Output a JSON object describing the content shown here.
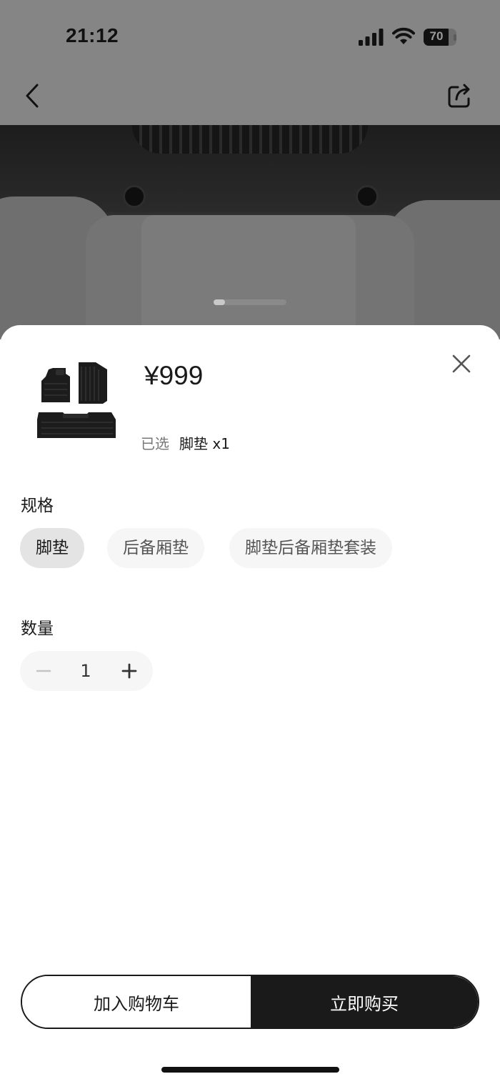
{
  "status_bar": {
    "time": "21:12",
    "battery": "70",
    "icons": [
      "signal-icon",
      "wifi-icon",
      "battery-icon"
    ]
  },
  "header": {
    "back_icon": "chevron-left-icon",
    "share_icon": "share-icon"
  },
  "hero": {
    "carousel_page": 1
  },
  "sheet": {
    "price": "¥999",
    "selected_label": "已选",
    "selected_value": "脚垫 x1",
    "close_icon": "close-icon",
    "spec": {
      "title": "规格",
      "options": [
        {
          "label": "脚垫",
          "selected": true
        },
        {
          "label": "后备厢垫",
          "selected": false
        },
        {
          "label": "脚垫后备厢垫套装",
          "selected": false
        }
      ]
    },
    "quantity": {
      "title": "数量",
      "value": "1"
    },
    "actions": {
      "add_to_cart": "加入购物车",
      "buy_now": "立即购买"
    }
  },
  "colors": {
    "dim_overlay": "#858585",
    "primary_dark": "#1a1a1a",
    "chip_selected": "#e4e4e4",
    "chip_default": "#f6f6f6"
  }
}
